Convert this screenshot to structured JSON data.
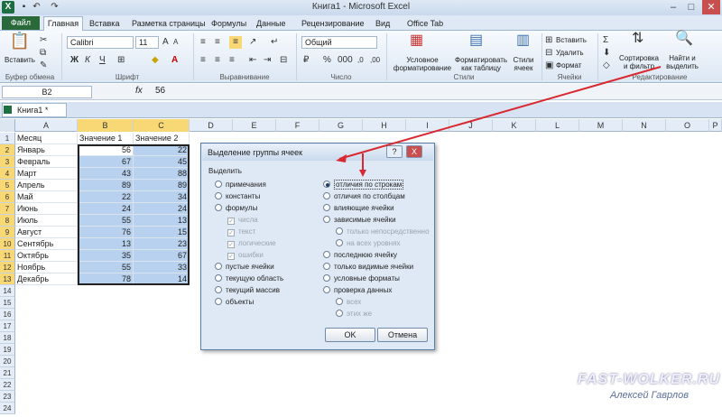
{
  "window": {
    "title": "Книга1 - Microsoft Excel"
  },
  "tabs": [
    "Файл",
    "Главная",
    "Вставка",
    "Разметка страницы",
    "Формулы",
    "Данные",
    "Рецензирование",
    "Вид",
    "Office Tab"
  ],
  "ribbon": {
    "paste": "Вставить",
    "font_name": "Calibri",
    "font_size": "11",
    "bold": "Ж",
    "italic": "К",
    "underline": "Ч",
    "number_format": "Общий",
    "cond_format": "Условное форматирование",
    "format_table": "Форматировать как таблицу",
    "cell_styles": "Стили ячеек",
    "insert": "Вставить",
    "delete": "Удалить",
    "format": "Формат",
    "sort_filter": "Сортировка и фильтр",
    "find_select": "Найти и выделить",
    "groups": [
      "Буфер обмена",
      "Шрифт",
      "Выравнивание",
      "Число",
      "Стили",
      "Ячейки",
      "Редактирование"
    ]
  },
  "formula_bar": {
    "name_box": "B2",
    "fx": "fx",
    "value": "56"
  },
  "workbook_tab": "Книга1 *",
  "columns": [
    "A",
    "B",
    "C",
    "D",
    "E",
    "F",
    "G",
    "H",
    "I",
    "J",
    "K",
    "L",
    "M",
    "N",
    "O",
    "P"
  ],
  "rows": [
    "1",
    "2",
    "3",
    "4",
    "5",
    "6",
    "7",
    "8",
    "9",
    "10",
    "11",
    "12",
    "13",
    "14",
    "15",
    "16",
    "17",
    "18",
    "19",
    "20",
    "21",
    "22",
    "23",
    "24"
  ],
  "sheet": {
    "headers": [
      "Месяц",
      "Значение 1",
      "Значение 2"
    ],
    "data": [
      [
        "Январь",
        "56",
        "22"
      ],
      [
        "Февраль",
        "67",
        "45"
      ],
      [
        "Март",
        "43",
        "88"
      ],
      [
        "Апрель",
        "89",
        "89"
      ],
      [
        "Май",
        "22",
        "34"
      ],
      [
        "Июнь",
        "24",
        "24"
      ],
      [
        "Июль",
        "55",
        "13"
      ],
      [
        "Август",
        "76",
        "15"
      ],
      [
        "Сентябрь",
        "13",
        "23"
      ],
      [
        "Октябрь",
        "35",
        "67"
      ],
      [
        "Ноябрь",
        "55",
        "33"
      ],
      [
        "Декабрь",
        "78",
        "14"
      ]
    ]
  },
  "dialog": {
    "title": "Выделение группы ячеек",
    "section": "Выделить",
    "left": [
      {
        "label": "примечания",
        "type": "radio"
      },
      {
        "label": "константы",
        "type": "radio"
      },
      {
        "label": "формулы",
        "type": "radio"
      },
      {
        "label": "числа",
        "type": "check"
      },
      {
        "label": "текст",
        "type": "check"
      },
      {
        "label": "логические",
        "type": "check"
      },
      {
        "label": "ошибки",
        "type": "check"
      },
      {
        "label": "пустые ячейки",
        "type": "radio"
      },
      {
        "label": "текущую область",
        "type": "radio"
      },
      {
        "label": "текущий массив",
        "type": "radio"
      },
      {
        "label": "объекты",
        "type": "radio"
      }
    ],
    "right": [
      {
        "label": "отличия по строкам",
        "type": "radio",
        "selected": true
      },
      {
        "label": "отличия по столбцам",
        "type": "radio"
      },
      {
        "label": "влияющие ячейки",
        "type": "radio"
      },
      {
        "label": "зависимые ячейки",
        "type": "radio"
      },
      {
        "label": "только непосредственно",
        "type": "subradio"
      },
      {
        "label": "на всех уровнях",
        "type": "subradio"
      },
      {
        "label": "последнюю ячейку",
        "type": "radio"
      },
      {
        "label": "только видимые ячейки",
        "type": "radio"
      },
      {
        "label": "условные форматы",
        "type": "radio"
      },
      {
        "label": "проверка данных",
        "type": "radio"
      },
      {
        "label": "всех",
        "type": "subradio"
      },
      {
        "label": "этих же",
        "type": "subradio"
      }
    ],
    "ok": "OK",
    "cancel": "Отмена",
    "help": "?",
    "close": "X"
  },
  "watermark": "FAST-WOLKER.RU",
  "author": "Алексей Гаврлов",
  "colors": {
    "accent": "#1d6f42",
    "selection": "#b7d1ef",
    "arrow": "#d9282f"
  }
}
